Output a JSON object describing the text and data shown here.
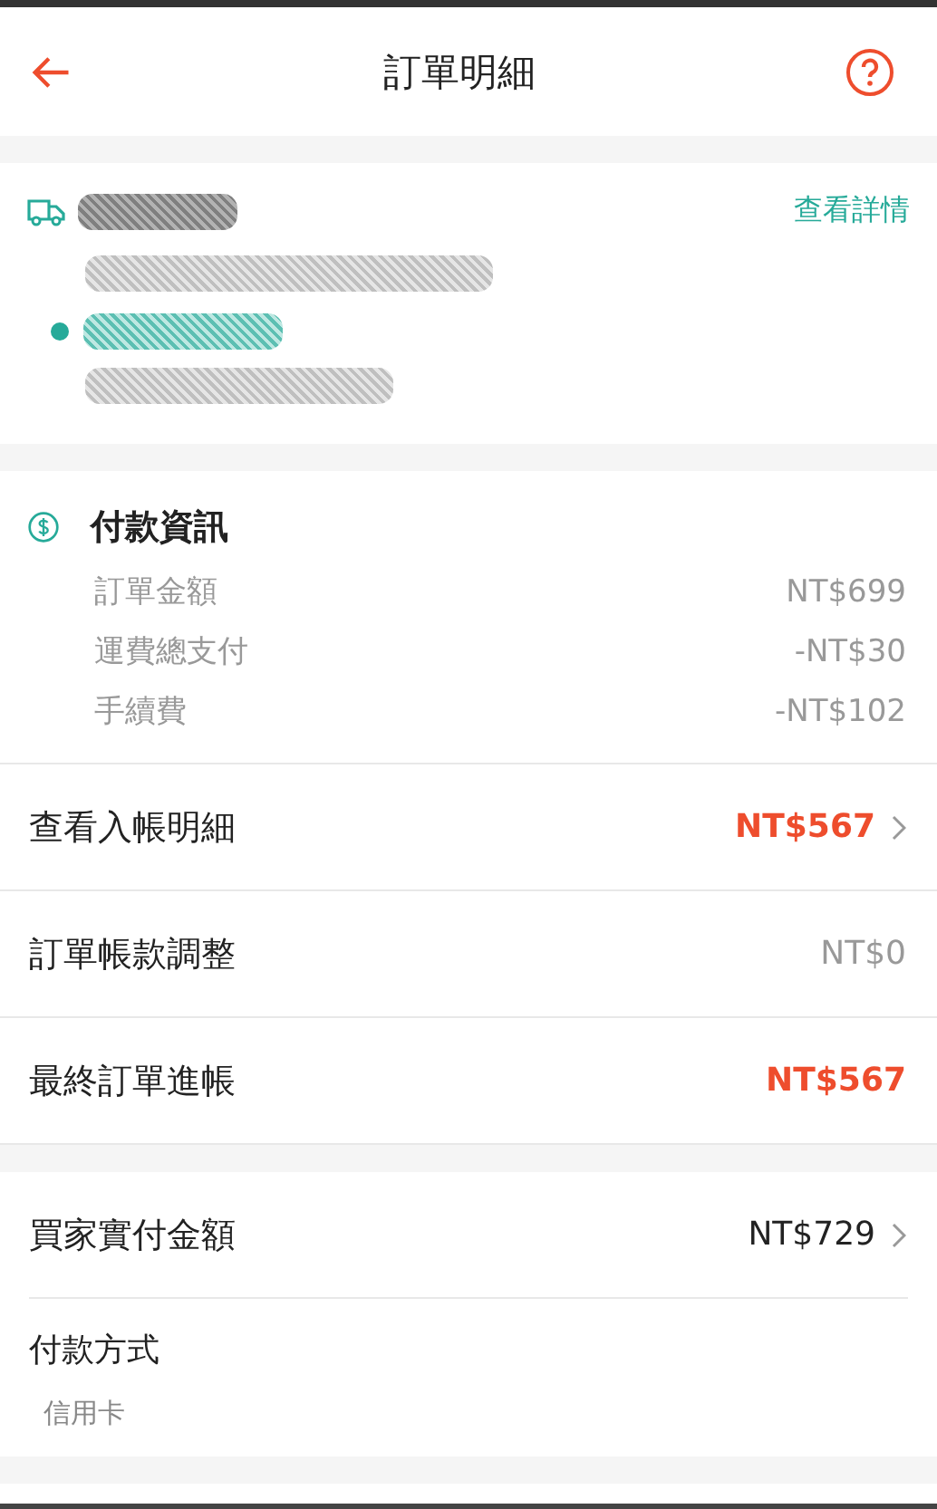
{
  "header": {
    "title": "訂單明細"
  },
  "shipment": {
    "link": "查看詳情"
  },
  "payment_info": {
    "title": "付款資訊",
    "lines": [
      {
        "label": "訂單金額",
        "amount": "NT$699"
      },
      {
        "label": "運費總支付",
        "amount": "-NT$30"
      },
      {
        "label": "手續費",
        "amount": "-NT$102"
      }
    ]
  },
  "summary_rows": [
    {
      "label": "查看入帳明細",
      "amount": "NT$567",
      "color": "#ee4d2d",
      "bold": true,
      "chevron": true
    },
    {
      "label": "訂單帳款調整",
      "amount": "NT$0",
      "color": "#999999",
      "bold": false,
      "chevron": false
    },
    {
      "label": "最終訂單進帳",
      "amount": "NT$567",
      "color": "#ee4d2d",
      "bold": true,
      "chevron": false
    }
  ],
  "buyer_row": {
    "label": "買家實付金額",
    "amount": "NT$729",
    "color": "#222222",
    "bold": false,
    "chevron": true
  },
  "payment_method": {
    "title": "付款方式",
    "value": "信用卡"
  }
}
